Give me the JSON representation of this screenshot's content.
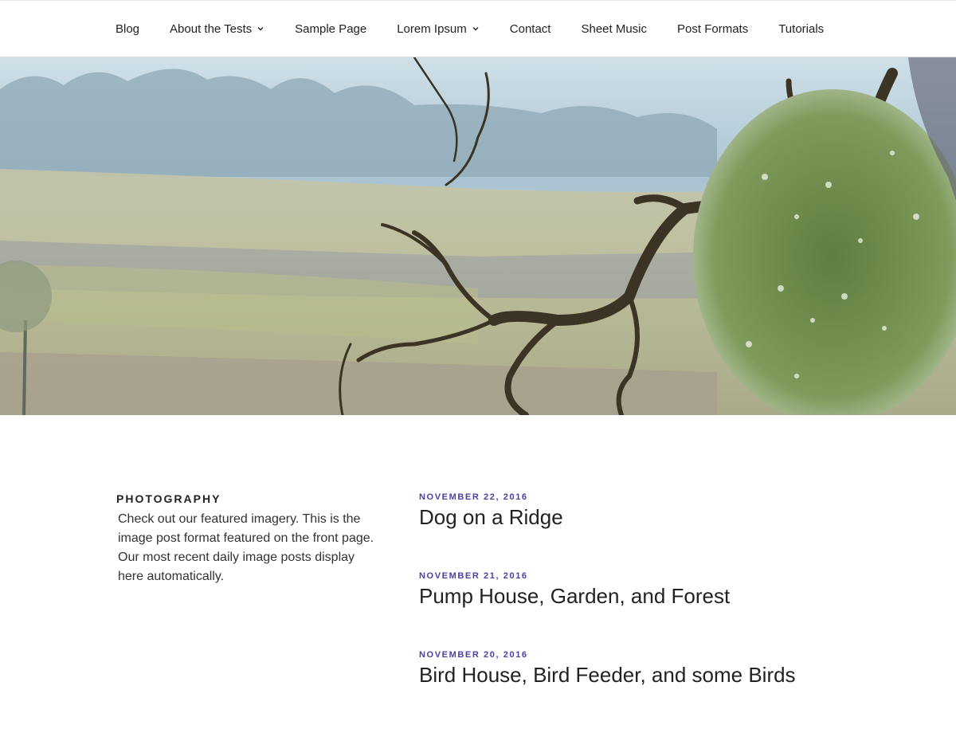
{
  "nav": {
    "items": [
      {
        "label": "Blog",
        "has_dropdown": false
      },
      {
        "label": "About the Tests",
        "has_dropdown": true
      },
      {
        "label": "Sample Page",
        "has_dropdown": false
      },
      {
        "label": "Lorem Ipsum",
        "has_dropdown": true
      },
      {
        "label": "Contact",
        "has_dropdown": false
      },
      {
        "label": "Sheet Music",
        "has_dropdown": false
      },
      {
        "label": "Post Formats",
        "has_dropdown": false
      },
      {
        "label": "Tutorials",
        "has_dropdown": false
      }
    ],
    "dropdown_icon": "chevron-down-icon"
  },
  "widget": {
    "title": "PHOTOGRAPHY",
    "text": "Check out our featured imagery. This is the image post format featured on the front page. Our most recent daily image posts display here automatically."
  },
  "posts": [
    {
      "date": "NOVEMBER 22, 2016",
      "title": "Dog on a Ridge"
    },
    {
      "date": "NOVEMBER 21, 2016",
      "title": "Pump House, Garden, and Forest"
    },
    {
      "date": "NOVEMBER 20, 2016",
      "title": "Bird House, Bird Feeder, and some Birds"
    }
  ],
  "colors": {
    "date_accent": "#4e3fa3",
    "text": "#222222"
  }
}
